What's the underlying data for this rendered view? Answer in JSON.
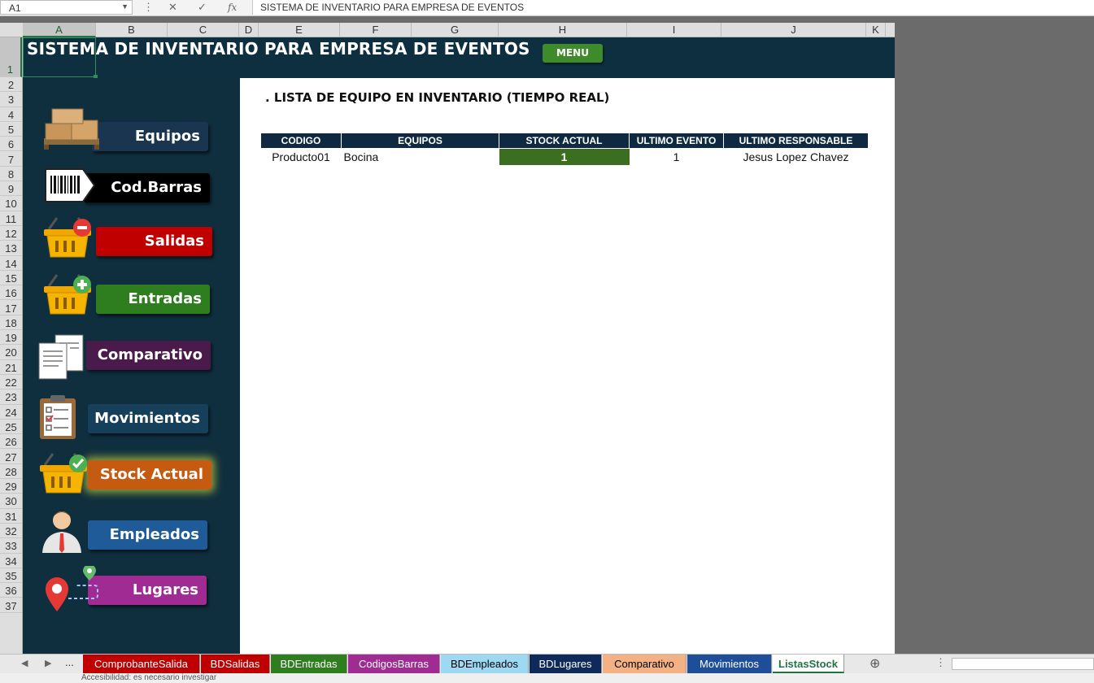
{
  "formula_bar": {
    "name_box": "A1",
    "formula": "SISTEMA DE INVENTARIO PARA EMPRESA DE EVENTOS",
    "fx": "fx"
  },
  "columns": [
    "A",
    "B",
    "C",
    "D",
    "E",
    "F",
    "G",
    "H",
    "I",
    "J",
    "K"
  ],
  "rows": [
    "1",
    "2",
    "3",
    "4",
    "5",
    "6",
    "7",
    "8",
    "9",
    "10",
    "11",
    "12",
    "13",
    "14",
    "15",
    "16",
    "17",
    "18",
    "19",
    "20",
    "21",
    "22",
    "23",
    "24",
    "25",
    "26",
    "27",
    "28",
    "29",
    "30",
    "31",
    "32",
    "33",
    "34",
    "35",
    "36",
    "37"
  ],
  "header": {
    "title": "SISTEMA DE INVENTARIO PARA EMPRESA DE EVENTOS",
    "menu_label": "MENU"
  },
  "sidebar": {
    "items": [
      {
        "label": "Equipos",
        "icon": "boxes-icon",
        "color": "#1a3550"
      },
      {
        "label": "Cod.Barras",
        "icon": "barcode-icon",
        "color": "#000000"
      },
      {
        "label": "Salidas",
        "icon": "basket-minus-icon",
        "color": "#c00000"
      },
      {
        "label": "Entradas",
        "icon": "basket-plus-icon",
        "color": "#2e7d1e"
      },
      {
        "label": "Comparativo",
        "icon": "documents-icon",
        "color": "#4a1a4a"
      },
      {
        "label": "Movimientos",
        "icon": "clipboard-icon",
        "color": "#16405a"
      },
      {
        "label": "Stock Actual",
        "icon": "basket-check-icon",
        "color": "#c55a11"
      },
      {
        "label": "Empleados",
        "icon": "person-icon",
        "color": "#1f5a99"
      },
      {
        "label": "Lugares",
        "icon": "location-pin-icon",
        "color": "#a02b93"
      }
    ]
  },
  "main": {
    "list_title": ". LISTA DE EQUIPO EN INVENTARIO (TIEMPO REAL)",
    "table": {
      "headers": [
        "CODIGO",
        "EQUIPOS",
        "STOCK ACTUAL",
        "ULTIMO EVENTO",
        "ULTIMO RESPONSABLE"
      ],
      "rows": [
        [
          "Producto01",
          "Bocina",
          "1",
          "1",
          "Jesus Lopez Chavez"
        ]
      ]
    }
  },
  "tabs": {
    "ellipsis": "...",
    "items": [
      {
        "label": "ComprobanteSalida",
        "bg": "#c00000",
        "fg": "#ffffff"
      },
      {
        "label": "BDSalidas",
        "bg": "#c00000",
        "fg": "#ffffff"
      },
      {
        "label": "BDEntradas",
        "bg": "#2e7d1e",
        "fg": "#ffffff"
      },
      {
        "label": "CodigosBarras",
        "bg": "#a02b93",
        "fg": "#ffffff"
      },
      {
        "label": "BDEmpleados",
        "bg": "#9dd9f3",
        "fg": "#000000"
      },
      {
        "label": "BDLugares",
        "bg": "#0e2a5a",
        "fg": "#ffffff"
      },
      {
        "label": "Comparativo",
        "bg": "#f4b183",
        "fg": "#000000"
      },
      {
        "label": "Movimientos",
        "bg": "#1f4e99",
        "fg": "#ffffff"
      },
      {
        "label": "ListasStock",
        "bg": "#ffffff",
        "fg": "#217346"
      }
    ]
  },
  "status": {
    "text": "Accesibilidad: es necesario investigar"
  }
}
